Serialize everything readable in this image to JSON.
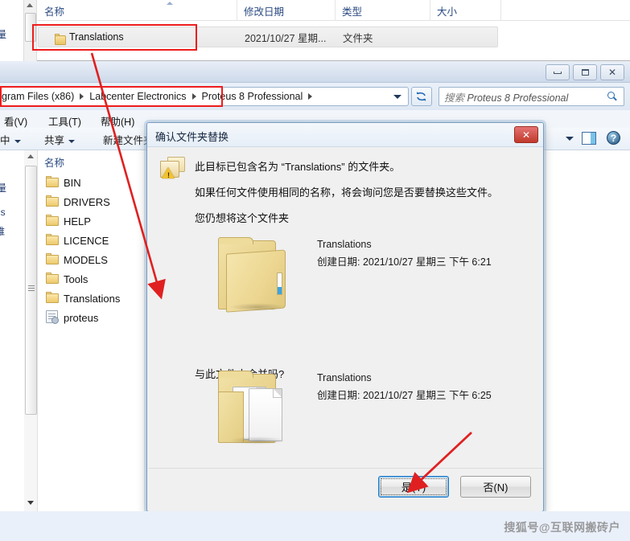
{
  "top_window": {
    "columns": [
      "名称",
      "修改日期",
      "类型",
      "大小"
    ],
    "row": {
      "name": "Translations",
      "date": "2021/10/27 星期...",
      "type": "文件夹",
      "size": ""
    },
    "left_edge_text": "量"
  },
  "explorer": {
    "window_controls": {
      "minimize": "最小化",
      "maximize": "最大化",
      "close": "关闭"
    },
    "address": {
      "crumbs": [
        "gram Files (x86)",
        "Labcenter Electronics",
        "Proteus 8 Professional"
      ],
      "refresh_label": "刷新"
    },
    "search": {
      "placeholder_prefix": "搜索 ",
      "placeholder_target": "Proteus 8 Professional"
    },
    "menu": [
      {
        "label": "看(V)"
      },
      {
        "label": "工具(T)"
      },
      {
        "label": "帮助(H)"
      }
    ],
    "commands": [
      {
        "label": "中"
      },
      {
        "label": "共享"
      },
      {
        "label": "新建文件夹"
      }
    ],
    "content": {
      "header": "名称",
      "left_edge_lines": [
        "量",
        "ds",
        "维"
      ],
      "items": [
        {
          "name": "BIN",
          "icon": "folder-icon"
        },
        {
          "name": "DRIVERS",
          "icon": "folder-icon"
        },
        {
          "name": "HELP",
          "icon": "folder-icon"
        },
        {
          "name": "LICENCE",
          "icon": "folder-icon"
        },
        {
          "name": "MODELS",
          "icon": "folder-icon"
        },
        {
          "name": "Tools",
          "icon": "folder-icon"
        },
        {
          "name": "Translations",
          "icon": "folder-icon"
        },
        {
          "name": "proteus",
          "icon": "config-file-icon"
        }
      ]
    }
  },
  "dialog": {
    "title": "确认文件夹替换",
    "close_label": "✕",
    "message_line1": "此目标已包含名为 “Translations” 的文件夹。",
    "message_line2": "如果任何文件使用相同的名称，将会询问您是否要替换这些文件。",
    "message_line3": "您仍想将这个文件夹",
    "merge_question": "与此文件夹合并吗?",
    "source": {
      "name": "Translations",
      "date": "创建日期: 2021/10/27 星期三 下午 6:21"
    },
    "target": {
      "name": "Translations",
      "date": "创建日期: 2021/10/27 星期三 下午 6:25"
    },
    "buttons": {
      "yes": "是(Y)",
      "yes_key": "Y",
      "yes_prefix": "是(",
      "yes_suffix": ")",
      "no": "否(N)",
      "no_key": "N",
      "no_prefix": "否(",
      "no_suffix": ")"
    }
  },
  "annotations": {
    "highlight_color": "#ee1c1c",
    "arrow_color": "#e02020",
    "boxes": [
      "top-folder-row",
      "address-breadcrumb"
    ],
    "arrows": [
      "top-row-to-translations-item",
      "pointer-to-yes-button"
    ]
  },
  "watermark": {
    "text": "搜狐号@互联网搬砖户"
  }
}
